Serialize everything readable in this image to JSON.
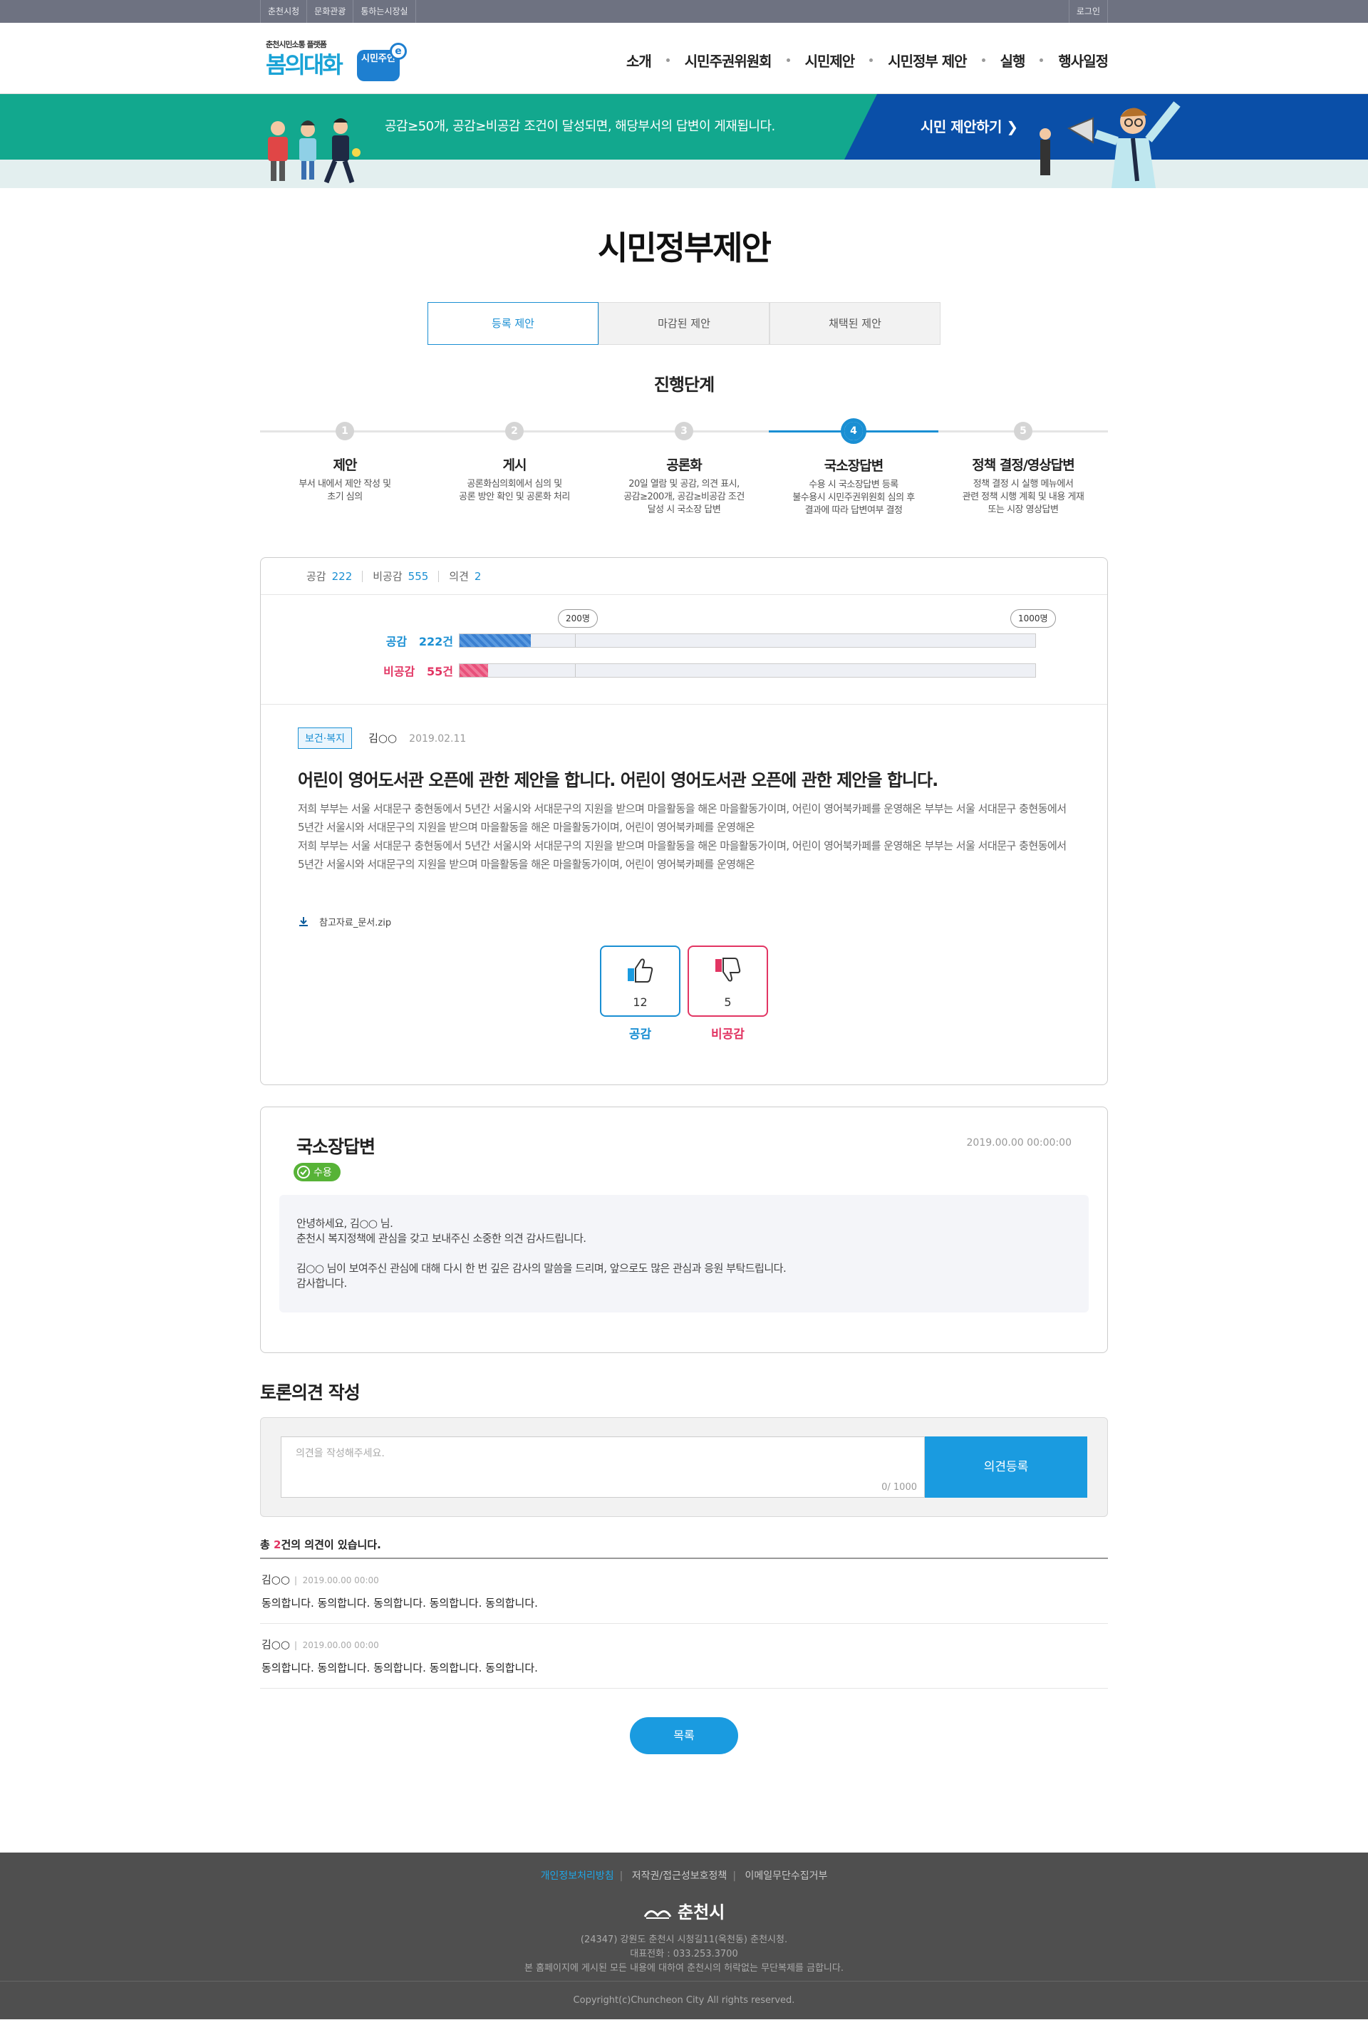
{
  "util": {
    "links": [
      "춘천시청",
      "문화관광",
      "통하는시장실"
    ],
    "login": "로그인"
  },
  "logo": {
    "sub": "춘천시민소통 플랫폼",
    "main": "봄의대화",
    "badge": "시민주인",
    "badge_e": "e"
  },
  "nav": [
    "소개",
    "시민주권위원회",
    "시민제안",
    "시민정부 제안",
    "실행",
    "행사일정"
  ],
  "banner": {
    "text": "공감≥50개, 공감≥비공감 조건이 달성되면, 해당부서의 답변이 게재됩니다.",
    "cta": "시민 제안하기 ❯"
  },
  "page_title": "시민정부제안",
  "tabs": [
    {
      "label": "등록 제안",
      "active": true
    },
    {
      "label": "마감된 제안",
      "active": false
    },
    {
      "label": "채택된 제안",
      "active": false
    }
  ],
  "steps_title": "진행단계",
  "steps": [
    {
      "num": "1",
      "title": "제안",
      "desc": "부서 내에서 제안 작성 및\n초기 심의"
    },
    {
      "num": "2",
      "title": "게시",
      "desc": "공론화심의회에서 심의 및\n공론 방안 확인 및 공론화 처리"
    },
    {
      "num": "3",
      "title": "공론화",
      "desc": "20일 열람 및 공감, 의견 표시,\n공감≥200개, 공감≥비공감 조건\n달성 시 국소장 답변"
    },
    {
      "num": "4",
      "title": "국소장답변",
      "desc": "수용 시 국소장답변 등록\n불수용시 시민주권위원회 심의 후\n결과에 따라 답변여부 결정",
      "active": true
    },
    {
      "num": "5",
      "title": "정책 결정/영상답변",
      "desc": "정책 결정 시 실행 메뉴에서\n관련 정책 시행 계획 및 내용 게재\n또는 시장 영상답변"
    }
  ],
  "summary": {
    "agree_label": "공감",
    "agree": "222",
    "disagree_label": "비공감",
    "disagree": "555",
    "opinion_label": "의견",
    "opinion": "2"
  },
  "gauge": {
    "marker1": "200명",
    "marker2": "1000명",
    "agree_label": "공감",
    "agree_count": "222건",
    "agree_fraction": 0.124,
    "disagree_label": "비공감",
    "disagree_count": "55건",
    "disagree_fraction": 0.05,
    "agree_color": "#3a7fd0",
    "disagree_color": "#e8507a"
  },
  "proposal": {
    "category": "보건·복지",
    "author": "김○○",
    "date": "2019.02.11",
    "title": "어린이 영어도서관 오픈에 관한 제안을 합니다. 어린이 영어도서관 오픈에 관한 제안을 합니다.",
    "body": "저희 부부는 서울 서대문구 충현동에서 5년간 서울시와 서대문구의 지원을 받으며 마을활동을 해온 마을활동가이며, 어린이 영어북카페를 운영해온 부부는 서울 서대문구 충현동에서 5년간 서울시와 서대문구의 지원을 받으며 마을활동을 해온 마을활동가이며, 어린이 영어북카페를 운영해온\n저희 부부는 서울 서대문구 충현동에서 5년간 서울시와 서대문구의 지원을 받으며 마을활동을 해온 마을활동가이며, 어린이 영어북카페를 운영해온 부부는 서울 서대문구 충현동에서 5년간 서울시와 서대문구의 지원을 받으며 마을활동을 해온 마을활동가이며, 어린이 영어북카페를 운영해온",
    "attachment": "참고자료_문서.zip",
    "up_count": "12",
    "down_count": "5",
    "up_label": "공감",
    "down_label": "비공감"
  },
  "answer": {
    "title": "국소장답변",
    "date": "2019.00.00 00:00:00",
    "status": "수용",
    "body": "안녕하세요, 김○○ 님.\n춘천시 복지정책에 관심을 갖고 보내주신 소중한 의견 감사드립니다.\n\n김○○ 님이 보여주신 관심에 대해 다시 한 번 깊은 감사의 말씀을 드리며, 앞으로도 많은 관심과 응원 부탁드립니다.\n감사합니다."
  },
  "comment_form": {
    "title": "토론의견 작성",
    "placeholder": "의견을 작성해주세요.",
    "counter": "0/ 1000",
    "submit": "의견등록"
  },
  "comments_total": {
    "prefix": "총 ",
    "count": "2",
    "suffix": "건의 의견이 있습니다."
  },
  "comments": [
    {
      "author": "김○○",
      "date": "2019.00.00   00:00",
      "text": "동의합니다. 동의합니다. 동의합니다. 동의합니다. 동의합니다."
    },
    {
      "author": "김○○",
      "date": "2019.00.00   00:00",
      "text": "동의합니다. 동의합니다. 동의합니다. 동의합니다. 동의합니다."
    }
  ],
  "list_button": "목록",
  "footer": {
    "links": [
      "개인정보처리방침",
      "저작권/접근성보호정책",
      "이메일무단수집거부"
    ],
    "logo": "춘천시",
    "address": "(24347) 강원도 춘천시 시청길11(옥천동) 춘천시청.",
    "tel": "대표전화 : 033.253.3700",
    "notice": "본 홈페이지에 게시된 모든 내용에 대하여 춘천시의 허락없는 무단복제를 금합니다.",
    "copyright": "Copyright(c)Chuncheon City All rights reserved."
  }
}
